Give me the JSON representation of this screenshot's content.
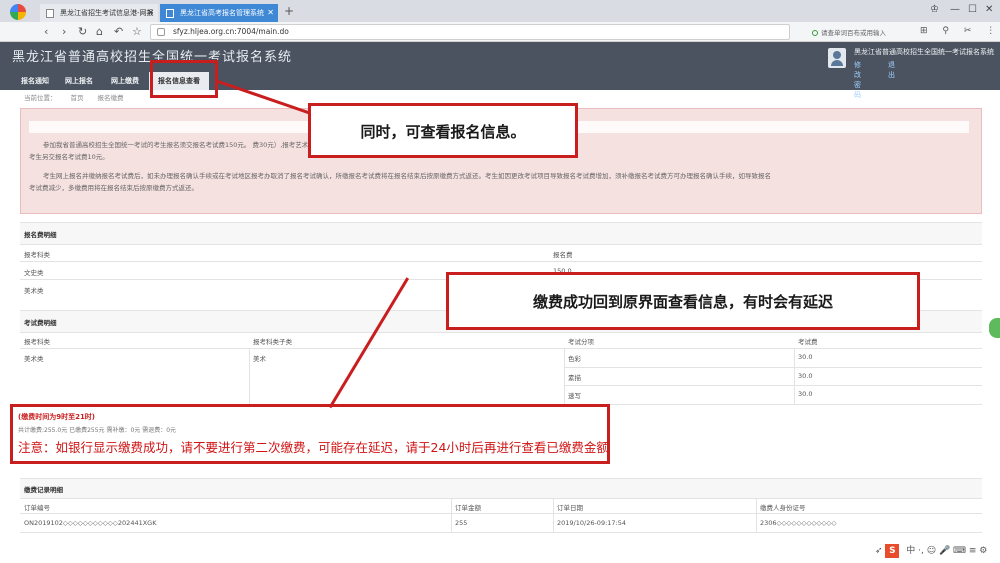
{
  "browser": {
    "tabs": [
      {
        "label": "黑龙江省招生考试信息港-网报"
      },
      {
        "label": "黑龙江省高考报名管理系统"
      }
    ],
    "url": "sfyz.hljea.org.cn:7004/main.do",
    "search_hint": "请查单词百布或用输入",
    "new_tab": "+"
  },
  "app": {
    "title": "黑龙江省普通高校招生全国统一考试报名系统",
    "nav": [
      "报名通知",
      "网上报名",
      "网上缴费",
      "报名信息查看"
    ],
    "user_name": "黑龙江省普通高校招生全国统一考试报名系统",
    "user_links": [
      "修改密码",
      "退出"
    ]
  },
  "breadcrumb": [
    "当前位置：",
    "首页",
    "报名缴费"
  ],
  "notice": {
    "lines": [
      "参加我省普通高校招生全国统一考试的考生报名须交报名考试费150元。                                                                                         费30元）,报考艺术类省级统考专业的考生另交专业课报名费15元，每报考一科交考试费30元,参加外语口试",
      "考生另交报名考试费10元。",
      "考生网上报名并缴纳报名考试费后，如未办理报名确认手续或在考试地区报考办取消了报名考试确认，所缴报名考试费将在报名结束后按原缴费方式返还。考生如因更改考试项目导致报名考试费增加，须补缴报名考试费方可办理报名确认手续，如导致报名",
      "考试费减少，多缴费用将在报名结束后按原缴费方式返还。"
    ]
  },
  "fee_table": {
    "title": "报名费明细",
    "headers": [
      "报考科类",
      "报名费"
    ],
    "rows": [
      [
        "文史类",
        "150.0"
      ],
      [
        "美术类",
        ""
      ]
    ]
  },
  "exam_table": {
    "title": "考试费明细",
    "headers": [
      "报考科类",
      "报考科类子类",
      "考试分项",
      "考试费"
    ],
    "rows": [
      [
        "美术类",
        "美术",
        "色彩",
        "30.0"
      ],
      [
        "",
        "",
        "素描",
        "30.0"
      ],
      [
        "",
        "",
        "速写",
        "30.0"
      ]
    ]
  },
  "payment": {
    "hours": "(缴费时间为9时至21时)",
    "summary": "共计缴费:255.0元 已缴费255元 需补缴：0元 需退费：0元",
    "warning": "注意：如银行显示缴费成功，请不要进行第二次缴费，可能存在延迟，请于24小时后再进行查看已缴费金额"
  },
  "records": {
    "title": "缴费记录明细",
    "headers": [
      "订单编号",
      "订单金额",
      "订单日期",
      "缴费人身份证号"
    ],
    "rows": [
      [
        "ON2019102◇◇◇◇◇◇◇◇◇◇◇202441XGK",
        "255",
        "2019/10/26-09:17:54",
        "2306◇◇◇◇◇◇◇◇◇◇◇◇"
      ]
    ]
  },
  "annotations": {
    "callout_top": "同时，可查看报名信息。",
    "callout_mid": "缴费成功回到原界面查看信息，有时会有延迟",
    "color": "#c81e1e"
  },
  "tray": {
    "label": "中 ·, ☺ 🎤 ⌨ ≡ ⚙"
  }
}
